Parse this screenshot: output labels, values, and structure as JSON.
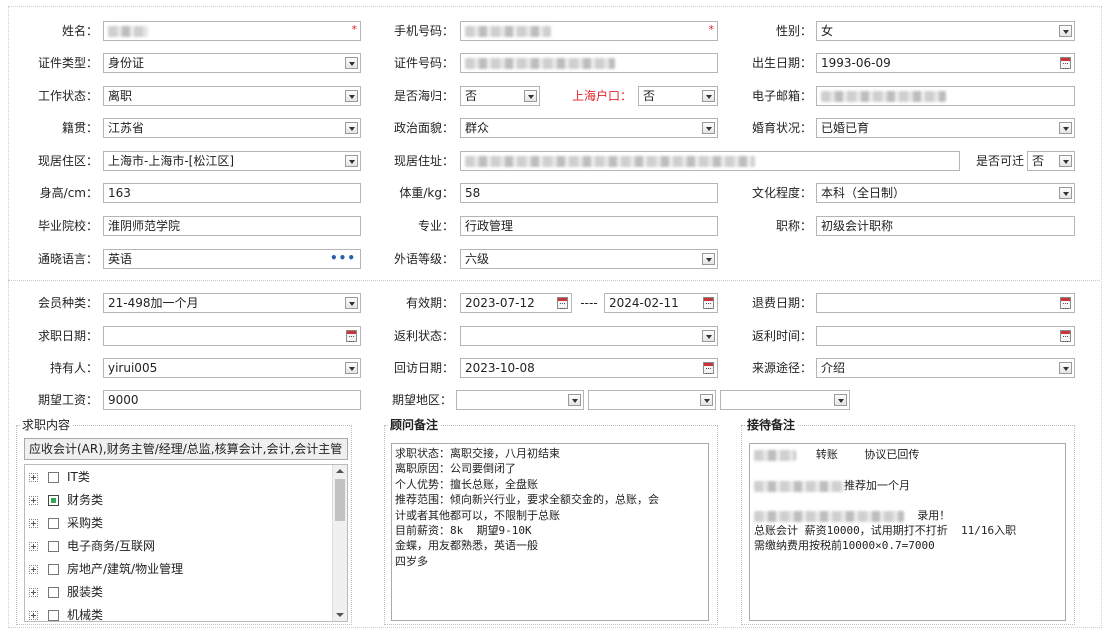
{
  "basic": {
    "name_label": "姓名：",
    "phone_label": "手机号码：",
    "gender_label": "性别：",
    "gender_value": "女",
    "id_type_label": "证件类型：",
    "id_type_value": "身份证",
    "id_no_label": "证件号码：",
    "birth_label": "出生日期：",
    "birth_value": "1993-06-09",
    "work_status_label": "工作状态：",
    "work_status_value": "离职",
    "overseas_label": "是否海归：",
    "overseas_value": "否",
    "hukou_label": "上海户口：",
    "hukou_value": "否",
    "email_label": "电子邮箱：",
    "native_label": "籍贯：",
    "native_value": "江苏省",
    "political_label": "政治面貌：",
    "political_value": "群众",
    "marital_label": "婚育状况：",
    "marital_value": "已婚已育",
    "residence_area_label": "现居住区：",
    "residence_area_value": "上海市-上海市-[松江区]",
    "residence_addr_label": "现居住址：",
    "relocate_label": "是否可迁",
    "relocate_value": "否",
    "height_label": "身高/cm：",
    "height_value": "163",
    "weight_label": "体重/kg：",
    "weight_value": "58",
    "education_label": "文化程度：",
    "education_value": "本科（全日制）",
    "school_label": "毕业院校：",
    "school_value": "淮阴师范学院",
    "major_label": "专业：",
    "major_value": "行政管理",
    "title_label": "职称：",
    "title_value": "初级会计职称",
    "language_label": "通晓语言：",
    "language_value": "英语",
    "language_more": "•••",
    "lang_level_label": "外语等级：",
    "lang_level_value": "六级"
  },
  "member": {
    "type_label": "会员种类：",
    "type_value": "21-498加一个月",
    "valid_label": "有效期：",
    "valid_from": "2023-07-12",
    "valid_sep": "----",
    "valid_to": "2024-02-11",
    "refund_date_label": "退费日期：",
    "job_date_label": "求职日期：",
    "rebate_status_label": "返利状态：",
    "rebate_time_label": "返利时间：",
    "holder_label": "持有人：",
    "holder_value": "yirui005",
    "visit_date_label": "回访日期：",
    "visit_date_value": "2023-10-08",
    "source_label": "来源途径：",
    "source_value": "介绍",
    "salary_label": "期望工资：",
    "salary_value": "9000",
    "region_label": "期望地区："
  },
  "job_panel": {
    "title": "求职内容",
    "summary": "应收会计(AR),财务主管/经理/总监,核算会计,会计,会计主管",
    "categories": [
      {
        "label": "IT类",
        "checked": "none"
      },
      {
        "label": "财务类",
        "checked": "partial"
      },
      {
        "label": "采购类",
        "checked": "none"
      },
      {
        "label": "电子商务/互联网",
        "checked": "none"
      },
      {
        "label": "房地产/建筑/物业管理",
        "checked": "none"
      },
      {
        "label": "服装类",
        "checked": "none"
      },
      {
        "label": "机械类",
        "checked": "none"
      }
    ]
  },
  "advisor_panel": {
    "title": "顾问备注",
    "text": "求职状态：离职交接，八月初结束\n离职原因：公司要倒闭了\n个人优势：擅长总账，全盘账\n推荐范围：倾向新兴行业，要求全额交金的，总账，会\n计或者其他都可以，不限制于总账\n目前薪资：8k  期望9-10K\n金蝶，用友都熟悉，英语一般\n四岁多"
  },
  "reception_panel": {
    "title": "接待备注",
    "line1": "转账    协议已回传",
    "line2": "推荐加一个月",
    "line3": "录用！",
    "line4": "总账会计 薪资10000，试用期打不打折  11/16入职",
    "line5": "需缴纳费用按税前10000×0.7=7000"
  }
}
